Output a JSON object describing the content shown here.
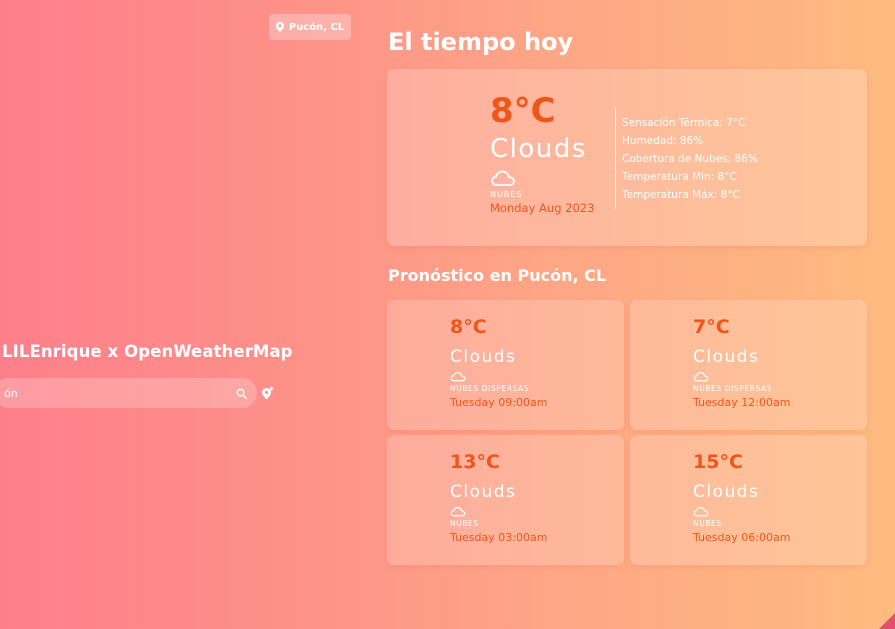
{
  "header": {
    "location_chip": "Pucón, CL"
  },
  "brand": {
    "title": "LILEnrique x OpenWeatherMap"
  },
  "search": {
    "value": "ón",
    "placeholder": ""
  },
  "today": {
    "heading": "El tiempo hoy",
    "temp": "8°C",
    "condition": "Clouds",
    "description": "NUBES",
    "date": "Monday Aug 2023",
    "details": [
      "Sensación Térmica: 7°C",
      "Humedad: 86%",
      "Cobertura de Nubes: 86%",
      "Temperatura Min: 8°C",
      "Temperatura Máx: 8°C"
    ]
  },
  "forecast": {
    "heading": "Pronóstico en Pucón, CL",
    "items": [
      {
        "temp": "8°C",
        "condition": "Clouds",
        "description": "NUBES DISPERSAS",
        "time": "Tuesday 09:00am"
      },
      {
        "temp": "7°C",
        "condition": "Clouds",
        "description": "NUBES DISPERSAS",
        "time": "Tuesday 12:00am"
      },
      {
        "temp": "13°C",
        "condition": "Clouds",
        "description": "NUBES",
        "time": "Tuesday 03:00am"
      },
      {
        "temp": "15°C",
        "condition": "Clouds",
        "description": "NUBES",
        "time": "Tuesday 06:00am"
      }
    ]
  },
  "icons": {
    "location": "map-pin-icon",
    "search": "search-icon",
    "locate": "location-pin-plus-icon",
    "weather": "cloud-icon"
  },
  "colors": {
    "accent": "#f0561a",
    "background_start": "#fe7f8a",
    "background_end": "#febb80"
  }
}
